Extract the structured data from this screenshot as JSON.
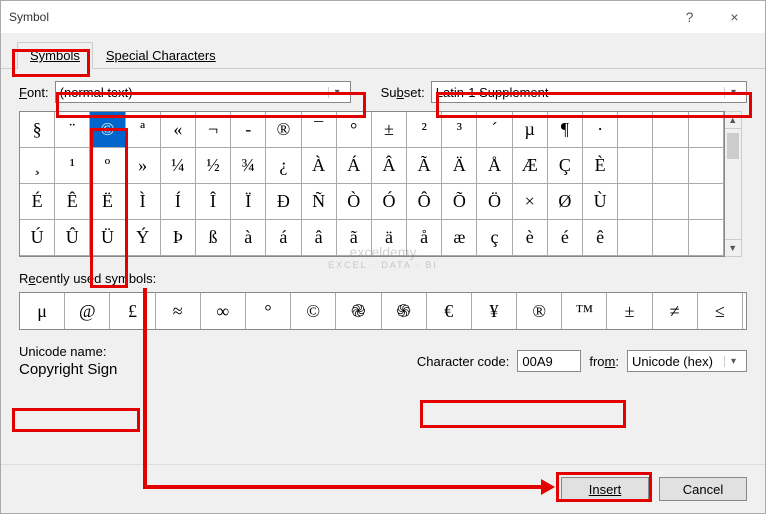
{
  "dialog": {
    "title": "Symbol",
    "help_icon": "?",
    "close_icon": "×"
  },
  "tabs": {
    "symbols": "Symbols",
    "special": "Special Characters"
  },
  "font": {
    "label_pre": "F",
    "label_post": "ont:",
    "value": "(normal text)"
  },
  "subset": {
    "label_pre": "Su",
    "label_u": "b",
    "label_post": "set:",
    "value": "Latin-1 Supplement"
  },
  "grid": {
    "rows": [
      [
        "§",
        "¨",
        "©",
        "ª",
        "«",
        "¬",
        "-",
        "®",
        "¯",
        "°",
        "±",
        "²",
        "³",
        "´",
        "µ",
        "¶",
        "·",
        "",
        "",
        " "
      ],
      [
        "¸",
        "¹",
        "º",
        "»",
        "¼",
        "½",
        "¾",
        "¿",
        "À",
        "Á",
        "Â",
        "Ã",
        "Ä",
        "Å",
        "Æ",
        "Ç",
        "È",
        "",
        "",
        ""
      ],
      [
        "É",
        "Ê",
        "Ë",
        "Ì",
        "Í",
        "Î",
        "Ï",
        "Ð",
        "Ñ",
        "Ò",
        "Ó",
        "Ô",
        "Õ",
        "Ö",
        "×",
        "Ø",
        "Ù",
        "",
        "",
        ""
      ],
      [
        "Ú",
        "Û",
        "Ü",
        "Ý",
        "Þ",
        "ß",
        "à",
        "á",
        "â",
        "ã",
        "ä",
        "å",
        "æ",
        "ç",
        "è",
        "é",
        "ê",
        "",
        "",
        ""
      ]
    ],
    "selected": {
      "row": 0,
      "col": 2
    }
  },
  "recent": {
    "label_pre": "R",
    "label_u": "e",
    "label_post": "cently used symbols:",
    "items": [
      "μ",
      "@",
      "£",
      "≈",
      "∞",
      "°",
      "©",
      "֎",
      "֍",
      "€",
      "¥",
      "®",
      "™",
      "±",
      "≠",
      "≤"
    ]
  },
  "unicode": {
    "label": "Unicode name:",
    "name": "Copyright Sign"
  },
  "charcode": {
    "label_pre": "C",
    "label_u": "h",
    "label_post": "aracter code:",
    "value": "00A9"
  },
  "from": {
    "label_pre": "fro",
    "label_u": "m",
    "label_post": ":",
    "value": "Unicode (hex)"
  },
  "buttons": {
    "insert": "Insert",
    "cancel": "Cancel"
  },
  "watermark": {
    "main": "exceldemy",
    "sub": "EXCEL · DATA · BI"
  }
}
